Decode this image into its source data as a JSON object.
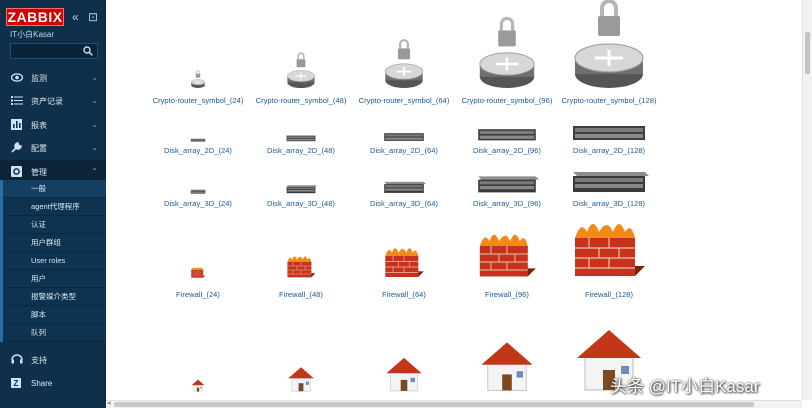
{
  "sidebar": {
    "logo": "ZABBIX",
    "user": "IT小白Kasar",
    "search_placeholder": "",
    "menu": [
      {
        "label": "监测",
        "icon": "eye-icon"
      },
      {
        "label": "资产记录",
        "icon": "list-icon"
      },
      {
        "label": "报表",
        "icon": "bar-chart-icon"
      },
      {
        "label": "配置",
        "icon": "wrench-icon"
      },
      {
        "label": "管理",
        "icon": "gear-icon"
      }
    ],
    "submenu": [
      {
        "label": "一般"
      },
      {
        "label": "agent代理程序"
      },
      {
        "label": "认证"
      },
      {
        "label": "用户群组"
      },
      {
        "label": "User roles"
      },
      {
        "label": "用户"
      },
      {
        "label": "报警媒介类型"
      },
      {
        "label": "脚本"
      },
      {
        "label": "队列"
      }
    ],
    "bottom": [
      {
        "label": "支持",
        "icon": "support-icon"
      },
      {
        "label": "Share",
        "icon": "share-icon"
      }
    ]
  },
  "icons": {
    "columns": [
      "24",
      "48",
      "64",
      "96",
      "128"
    ],
    "rows": [
      {
        "kind": "crypto-router",
        "names": [
          "Crypto-router_symbol_(24)",
          "Crypto-router_symbol_(48)",
          "Crypto-router_symbol_(64)",
          "Crypto-router_symbol_(96)",
          "Crypto-router_symbol_(128)"
        ]
      },
      {
        "kind": "disk-2d",
        "names": [
          "Disk_array_2D_(24)",
          "Disk_array_2D_(48)",
          "Disk_array_2D_(64)",
          "Disk_array_2D_(96)",
          "Disk_array_2D_(128)"
        ]
      },
      {
        "kind": "disk-3d",
        "names": [
          "Disk_array_3D_(24)",
          "Disk_array_3D_(48)",
          "Disk_array_3D_(64)",
          "Disk_array_3D_(96)",
          "Disk_array_3D_(128)"
        ]
      },
      {
        "kind": "firewall",
        "names": [
          "Firewall_(24)",
          "Firewall_(48)",
          "Firewall_(64)",
          "Firewall_(96)",
          "Firewall_(128)"
        ]
      },
      {
        "kind": "house",
        "names": [
          "",
          "",
          "",
          "",
          ""
        ]
      }
    ]
  },
  "watermark": "头条 @IT小白Kasar",
  "colors": {
    "sidebar": "#0f2f4a",
    "logo": "#d40000",
    "link": "#1a5c9a"
  }
}
